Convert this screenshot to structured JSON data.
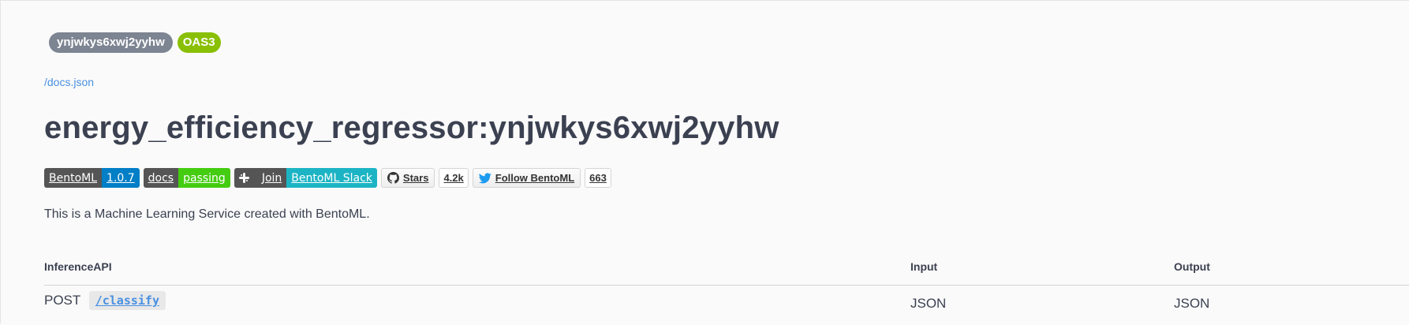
{
  "info": {
    "version": "ynjwkys6xwj2yyhw",
    "spec_badge": "OAS3",
    "docs_link": "/docs.json",
    "title": "energy_efficiency_regressor:ynjwkys6xwj2yyhw",
    "description": "This is a Machine Learning Service created with BentoML."
  },
  "badges": {
    "bentoml": {
      "left": "BentoML",
      "right": "1.0.7"
    },
    "docs": {
      "left": "docs",
      "right": "passing"
    },
    "slack": {
      "left": "Join",
      "right": "BentoML Slack"
    },
    "stars": {
      "label": "Stars",
      "count": "4.2k"
    },
    "follow": {
      "label": "Follow BentoML",
      "count": "663"
    }
  },
  "api_table": {
    "headers": {
      "api": "InferenceAPI",
      "input": "Input",
      "output": "Output"
    },
    "rows": [
      {
        "method": "POST",
        "route": "/classify",
        "input": "JSON",
        "output": "JSON"
      }
    ]
  },
  "colors": {
    "version_pill": "#7d8492",
    "oas_pill": "#89bf04",
    "link": "#4990e2",
    "text": "#3b4151"
  },
  "icons": {
    "slack": "slack-icon",
    "github": "github-icon",
    "twitter": "twitter-icon"
  }
}
